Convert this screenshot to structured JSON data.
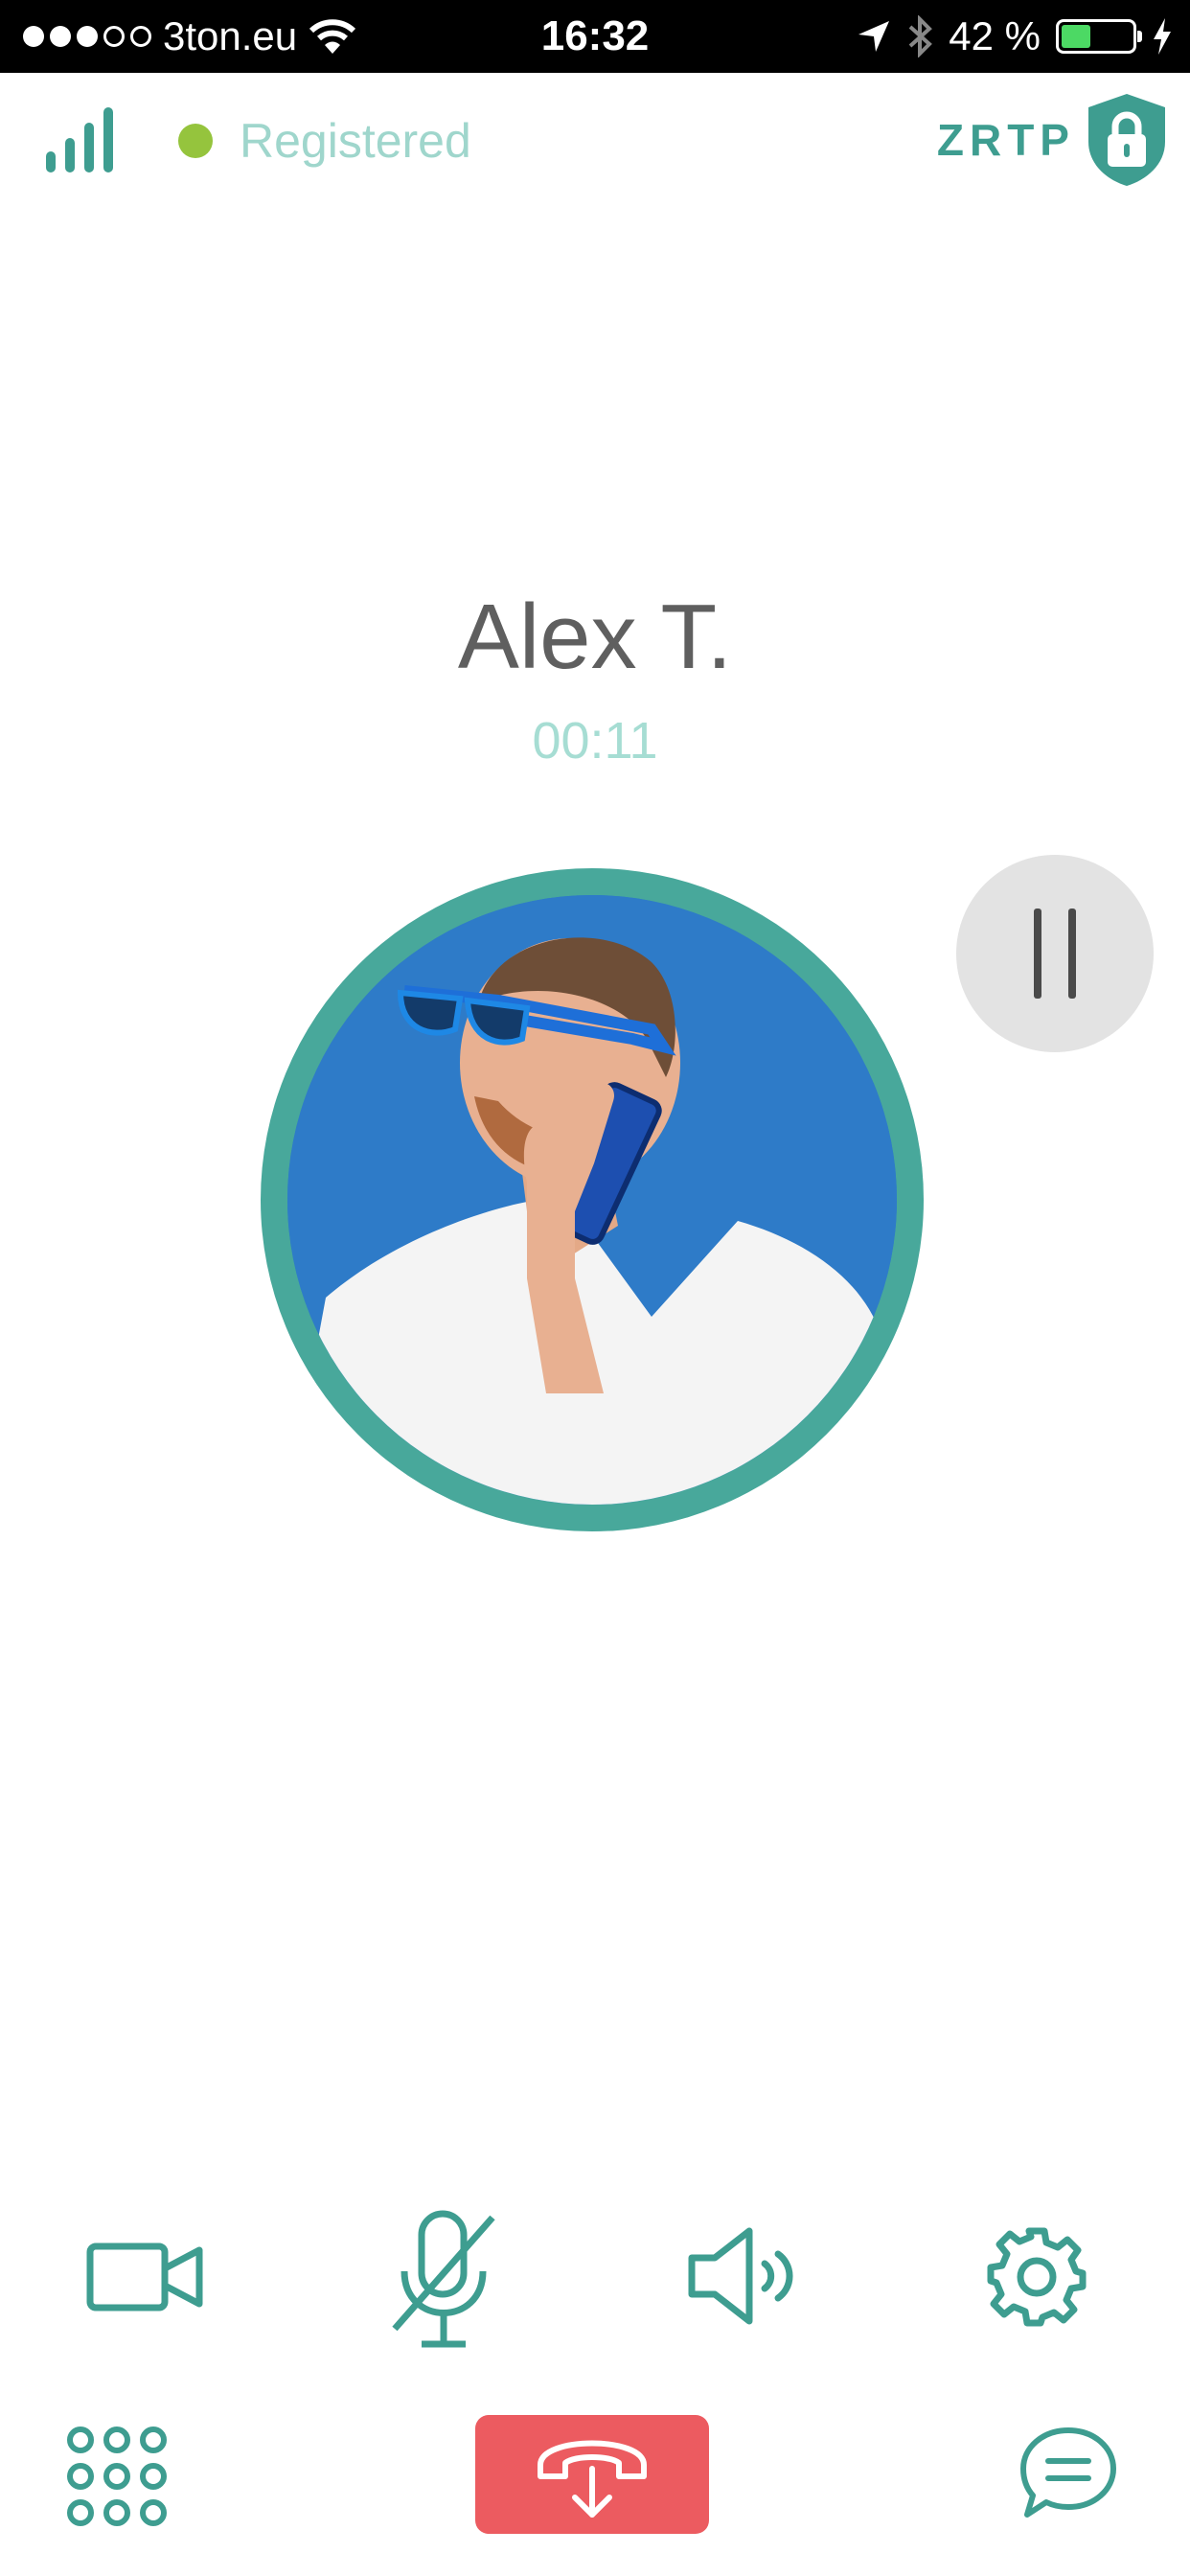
{
  "status_bar": {
    "carrier": "3ton.eu",
    "time": "16:32",
    "battery_percent": "42 %",
    "battery_level": 0.42,
    "signal_dots_filled": 3,
    "signal_dots_total": 5,
    "icons": [
      "wifi-icon",
      "location-arrow-icon",
      "bluetooth-icon",
      "battery-icon",
      "charging-bolt-icon"
    ]
  },
  "header": {
    "registration_status": "Registered",
    "registration_color": "#95c43d",
    "encryption_label": "ZRTP",
    "icons": [
      "signal-strength-icon",
      "lock-shield-icon"
    ]
  },
  "call": {
    "contact_name": "Alex T.",
    "duration": "00:11"
  },
  "controls": {
    "row1": [
      "video-camera-icon",
      "microphone-muted-icon",
      "speaker-icon",
      "settings-gear-icon"
    ],
    "row2": [
      "dialpad-icon",
      "hangup-transfer-icon",
      "chat-icon"
    ]
  },
  "colors": {
    "accent": "#3e9d90",
    "accent_light": "#a6ddd3",
    "hangup": "#ec5b60",
    "avatar_ring": "#48a89b",
    "avatar_bg": "#2e7bc8"
  }
}
